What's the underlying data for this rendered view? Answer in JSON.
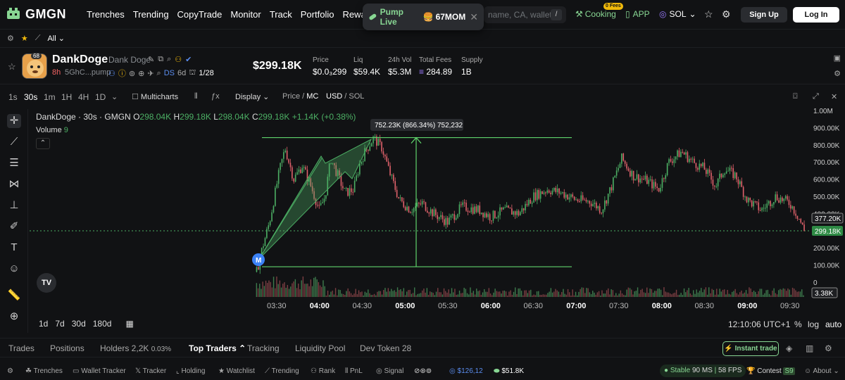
{
  "nav": {
    "logo": "GMGN",
    "links": [
      "Trenches",
      "Trending",
      "CopyTrade",
      "Monitor",
      "Track",
      "Portfolio",
      "Rewards"
    ],
    "pump_live": "Pump Live",
    "pump_token": "67MOM",
    "search_placeholder": "name, CA, wallet",
    "search_key": "/",
    "cooking": "Cooking",
    "fees_badge": "0 Fees",
    "app": "APP",
    "chain": "SOL",
    "signup": "Sign Up",
    "login": "Log In"
  },
  "row2": {
    "filter": "All"
  },
  "token": {
    "avatar_badge": "68",
    "name": "DankDoge",
    "symbol": "Dank Doge",
    "age": "8h",
    "ca": "5GhC...pump",
    "ds": "DS",
    "ds_age": "6d",
    "ratio": "1/28",
    "price": "$299.18K",
    "stats": [
      {
        "label": "Price",
        "value": "$0.0₃299"
      },
      {
        "label": "Liq",
        "value": "$59.4K"
      },
      {
        "label": "24h Vol",
        "value": "$5.3M"
      },
      {
        "label": "Total Fees",
        "value": "284.89"
      },
      {
        "label": "Supply",
        "value": "1B"
      }
    ]
  },
  "toolbar": {
    "timeframes": [
      "1s",
      "30s",
      "1m",
      "1H",
      "4H",
      "1D"
    ],
    "active_tf": "30s",
    "multicharts": "Multicharts",
    "display": "Display",
    "price_label": "Price",
    "mc_label": "MC",
    "usd_label": "USD",
    "sol_label": "SOL"
  },
  "chart": {
    "legend_title": "DankDoge · 30s · GMGN",
    "o_label": "O",
    "o": "298.04K",
    "h_label": "H",
    "h": "299.18K",
    "l_label": "L",
    "l": "298.04K",
    "c_label": "C",
    "c": "299.18K",
    "change": "+1.14K (+0.38%)",
    "volume_label": "Volume",
    "volume": "9",
    "measure_tooltip": "752.23K (866.34%) 752,232",
    "marker": "M",
    "tv_logo": "TV",
    "current_price_tag": "299.18K",
    "hover_price_tag": "377.20K",
    "volume_tag": "3.38K",
    "time_label": "12:10:06 UTC+1",
    "ranges": [
      "1d",
      "7d",
      "30d",
      "180d"
    ],
    "scale_pct": "%",
    "scale_log": "log",
    "scale_auto": "auto"
  },
  "chart_data": {
    "type": "candlestick",
    "y_ticks": [
      "1.00M",
      "900.00K",
      "800.00K",
      "700.00K",
      "600.00K",
      "500.00K",
      "400.00K",
      "300.00K",
      "200.00K",
      "100.00K",
      "0"
    ],
    "x_ticks": [
      "03:30",
      "04:00",
      "04:30",
      "05:00",
      "05:30",
      "06:00",
      "06:30",
      "07:00",
      "07:30",
      "08:00",
      "08:30",
      "09:00",
      "09:30"
    ],
    "x_ticks_bold": [
      "04:00",
      "05:00",
      "06:00",
      "07:00",
      "08:00",
      "09:00"
    ],
    "ylim": [
      0,
      1000000
    ],
    "price_path_mc": [
      [
        "03:16",
        60000
      ],
      [
        "03:20",
        200000
      ],
      [
        "03:25",
        350000
      ],
      [
        "03:32",
        650000
      ],
      [
        "03:36",
        780000
      ],
      [
        "03:42",
        600000
      ],
      [
        "03:48",
        680000
      ],
      [
        "03:54",
        560000
      ],
      [
        "04:00",
        420000
      ],
      [
        "04:04",
        500000
      ],
      [
        "04:08",
        720000
      ],
      [
        "04:12",
        640000
      ],
      [
        "04:18",
        520000
      ],
      [
        "04:24",
        540000
      ],
      [
        "04:28",
        680000
      ],
      [
        "04:32",
        760000
      ],
      [
        "04:38",
        840000
      ],
      [
        "04:44",
        780000
      ],
      [
        "04:50",
        620000
      ],
      [
        "04:56",
        480000
      ],
      [
        "05:04",
        420000
      ],
      [
        "05:12",
        460000
      ],
      [
        "05:20",
        400000
      ],
      [
        "05:30",
        350000
      ],
      [
        "05:40",
        440000
      ],
      [
        "05:52",
        420000
      ],
      [
        "06:00",
        380000
      ],
      [
        "06:10",
        420000
      ],
      [
        "06:20",
        400000
      ],
      [
        "06:30",
        500000
      ],
      [
        "06:40",
        540000
      ],
      [
        "06:50",
        520000
      ],
      [
        "07:00",
        480000
      ],
      [
        "07:10",
        470000
      ],
      [
        "07:18",
        420000
      ],
      [
        "07:25",
        560000
      ],
      [
        "07:32",
        720000
      ],
      [
        "07:40",
        620000
      ],
      [
        "07:50",
        590000
      ],
      [
        "07:58",
        540000
      ],
      [
        "08:05",
        700000
      ],
      [
        "08:14",
        760000
      ],
      [
        "08:22",
        700000
      ],
      [
        "08:30",
        660000
      ],
      [
        "08:38",
        560000
      ],
      [
        "08:44",
        660000
      ],
      [
        "08:52",
        620000
      ],
      [
        "09:00",
        480000
      ],
      [
        "09:10",
        420000
      ],
      [
        "09:20",
        500000
      ],
      [
        "09:30",
        460000
      ],
      [
        "09:36",
        380000
      ],
      [
        "09:40",
        299180
      ]
    ],
    "measure": {
      "from": 90000,
      "to": 842000,
      "label": "752.23K (866.34%) 752,232"
    }
  },
  "tabs": {
    "items": [
      "Trades",
      "Positions",
      "Holders 2,2K",
      "Top Traders",
      "Tracking",
      "Liquidity Pool",
      "Dev Token 28"
    ],
    "holders_pct": "0.03%",
    "instant_trade": "Instant trade"
  },
  "footer": {
    "items": [
      "Trenches",
      "Wallet Tracker",
      "Tracker",
      "Holding",
      "Watchlist",
      "Trending",
      "Rank",
      "PnL",
      "Signal"
    ],
    "balance1": "$126,12",
    "balance2": "$51.8K",
    "stable": "Stable",
    "ms": "90 MS",
    "fps": "58 FPS",
    "contest": "Contest",
    "contest_badge": "S9",
    "about": "About"
  }
}
